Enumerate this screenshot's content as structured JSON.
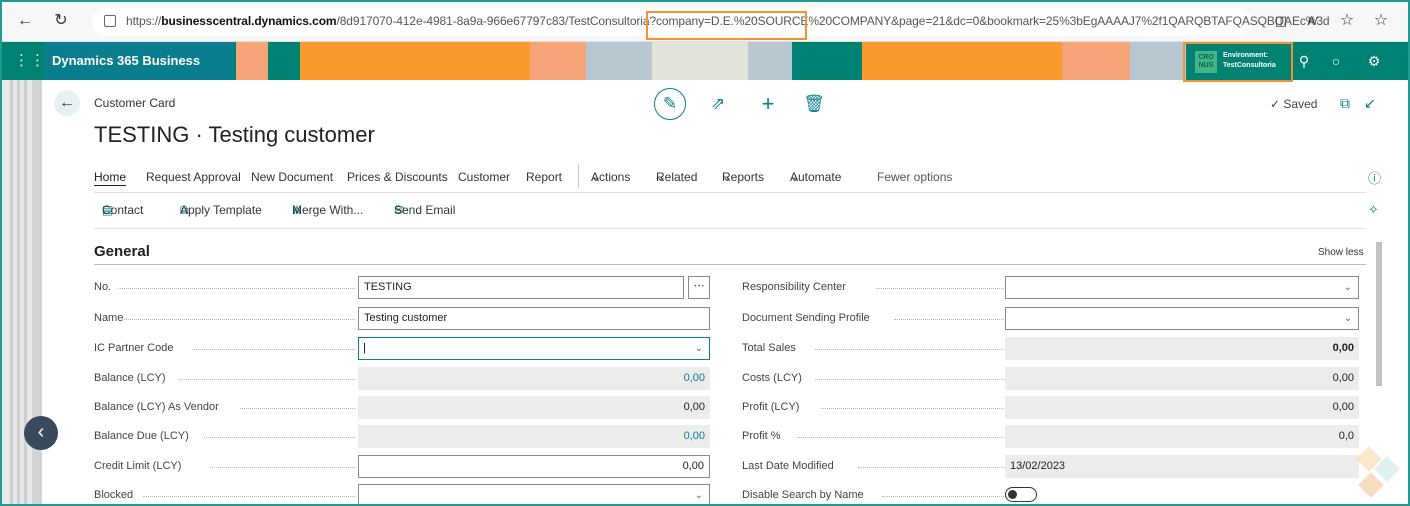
{
  "browser": {
    "url_prefix": "https://",
    "url_host": "businesscentral.dynamics.com",
    "url_rest": "/8d917070-412e-4981-8a9a-966e67797c83/TestConsultoria?company=D.E.%20SOURCE%20COMPANY&page=21&dc=0&bookmark=25%3bEgAAAAJ7%2f1QARQBTAFQASQBOAEc%3d",
    "icons": [
      "back-arrow-icon",
      "refresh-icon",
      "lock-icon",
      "split-screen-icon",
      "read-aloud-icon",
      "favorite-icon",
      "favorites-list-icon"
    ]
  },
  "app": {
    "title": "Dynamics 365 Business Central",
    "company_badge": "CRO\nNUS",
    "env_label": "Environment:",
    "env_name": "TestConsultoria",
    "colors": {
      "header": "#008272",
      "accent": "#0a7e8e",
      "highlight": "#f29233",
      "orange": "#f89a2e",
      "peach": "#f7a77a",
      "grey": "#b9c7d1"
    }
  },
  "page": {
    "breadcrumb": "Customer Card",
    "title": "TESTING · Testing customer",
    "saved": "Saved"
  },
  "nav": {
    "items": [
      "Home",
      "Request Approval",
      "New Document",
      "Prices & Discounts",
      "Customer",
      "Report"
    ],
    "menus": [
      "Actions",
      "Related",
      "Reports",
      "Automate"
    ],
    "fewer": "Fewer options"
  },
  "toolbar": {
    "contact": "Contact",
    "apply_template": "Apply Template",
    "merge_with": "Merge With...",
    "send_email": "Send Email"
  },
  "section": {
    "title": "General",
    "toggle": "Show less"
  },
  "left_fields": [
    {
      "label": "No.",
      "value": "TESTING"
    },
    {
      "label": "Name",
      "value": "Testing customer"
    },
    {
      "label": "IC Partner Code",
      "value": ""
    },
    {
      "label": "Balance (LCY)",
      "value": "0,00"
    },
    {
      "label": "Balance (LCY) As Vendor",
      "value": "0,00"
    },
    {
      "label": "Balance Due (LCY)",
      "value": "0,00"
    },
    {
      "label": "Credit Limit (LCY)",
      "value": "0,00"
    },
    {
      "label": "Blocked",
      "value": ""
    }
  ],
  "right_fields": [
    {
      "label": "Responsibility Center",
      "value": ""
    },
    {
      "label": "Document Sending Profile",
      "value": ""
    },
    {
      "label": "Total Sales",
      "value": "0,00"
    },
    {
      "label": "Costs (LCY)",
      "value": "0,00"
    },
    {
      "label": "Profit (LCY)",
      "value": "0,00"
    },
    {
      "label": "Profit %",
      "value": "0,0"
    },
    {
      "label": "Last Date Modified",
      "value": "13/02/2023"
    },
    {
      "label": "Disable Search by Name",
      "value": "off"
    }
  ]
}
